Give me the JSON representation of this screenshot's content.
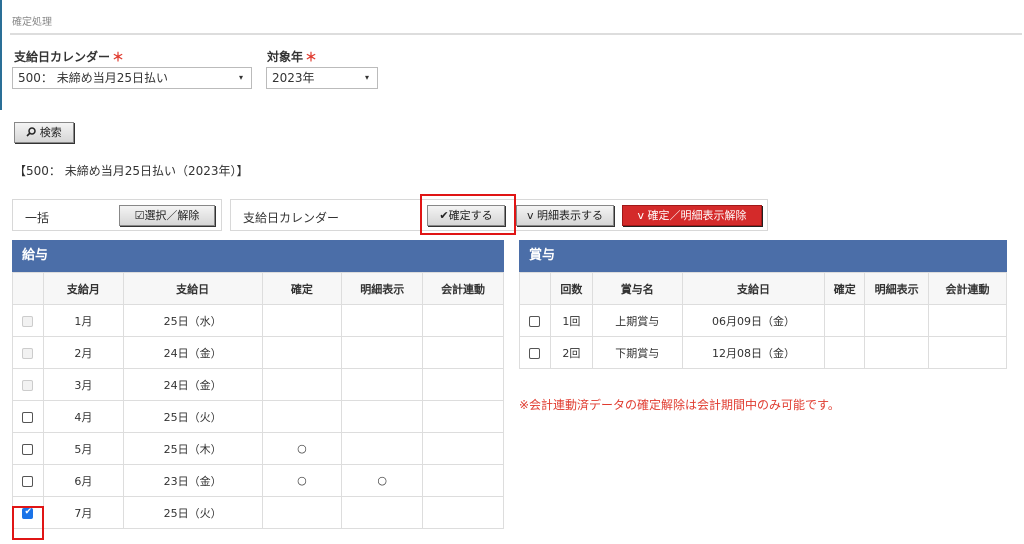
{
  "page": {
    "title": "確定処理"
  },
  "form": {
    "calendar_label": "支給日カレンダー",
    "calendar_value": "500： 未締め当月25日払い",
    "year_label": "対象年",
    "year_value": "2023年",
    "required_mark": "＊",
    "search_label": "検索",
    "caret": "▾"
  },
  "caption": "【500： 未締め当月25日払い（2023年）】",
  "toolbar": {
    "bulk_label": "一括",
    "select_toggle_label": "選択／解除",
    "calendar_label": "支給日カレンダー",
    "confirm_label": "確定する",
    "detail_show_label": "明細表示する",
    "cancel_label": "確定／明細表示解除"
  },
  "salary": {
    "title": "給与",
    "headers": [
      "",
      "支給月",
      "支給日",
      "確定",
      "明細表示",
      "会計連動"
    ],
    "rows": [
      {
        "state": "disabled",
        "month": "1月",
        "date": "25日（水）",
        "confirmed": "",
        "detail": "",
        "accounting": ""
      },
      {
        "state": "disabled",
        "month": "2月",
        "date": "24日（金）",
        "confirmed": "",
        "detail": "",
        "accounting": ""
      },
      {
        "state": "disabled",
        "month": "3月",
        "date": "24日（金）",
        "confirmed": "",
        "detail": "",
        "accounting": ""
      },
      {
        "state": "empty",
        "month": "4月",
        "date": "25日（火）",
        "confirmed": "",
        "detail": "",
        "accounting": ""
      },
      {
        "state": "empty",
        "month": "5月",
        "date": "25日（木）",
        "confirmed": "○",
        "detail": "",
        "accounting": ""
      },
      {
        "state": "empty",
        "month": "6月",
        "date": "23日（金）",
        "confirmed": "○",
        "detail": "○",
        "accounting": ""
      },
      {
        "state": "checked",
        "month": "7月",
        "date": "25日（火）",
        "confirmed": "",
        "detail": "",
        "accounting": ""
      }
    ]
  },
  "bonus": {
    "title": "賞与",
    "headers": [
      "",
      "回数",
      "賞与名",
      "支給日",
      "確定",
      "明細表示",
      "会計連動"
    ],
    "rows": [
      {
        "state": "empty",
        "count": "1回",
        "name": "上期賞与",
        "date": "06月09日（金）",
        "confirmed": "",
        "detail": "",
        "accounting": ""
      },
      {
        "state": "empty",
        "count": "2回",
        "name": "下期賞与",
        "date": "12月08日（金）",
        "confirmed": "",
        "detail": "",
        "accounting": ""
      }
    ]
  },
  "note": "※会計連動済データの確定解除は会計期間中のみ可能です。",
  "colors": {
    "header_bg": "#4b6ea8",
    "danger": "#d42a2a",
    "highlight": "#e01515",
    "required": "#e03b2f"
  }
}
